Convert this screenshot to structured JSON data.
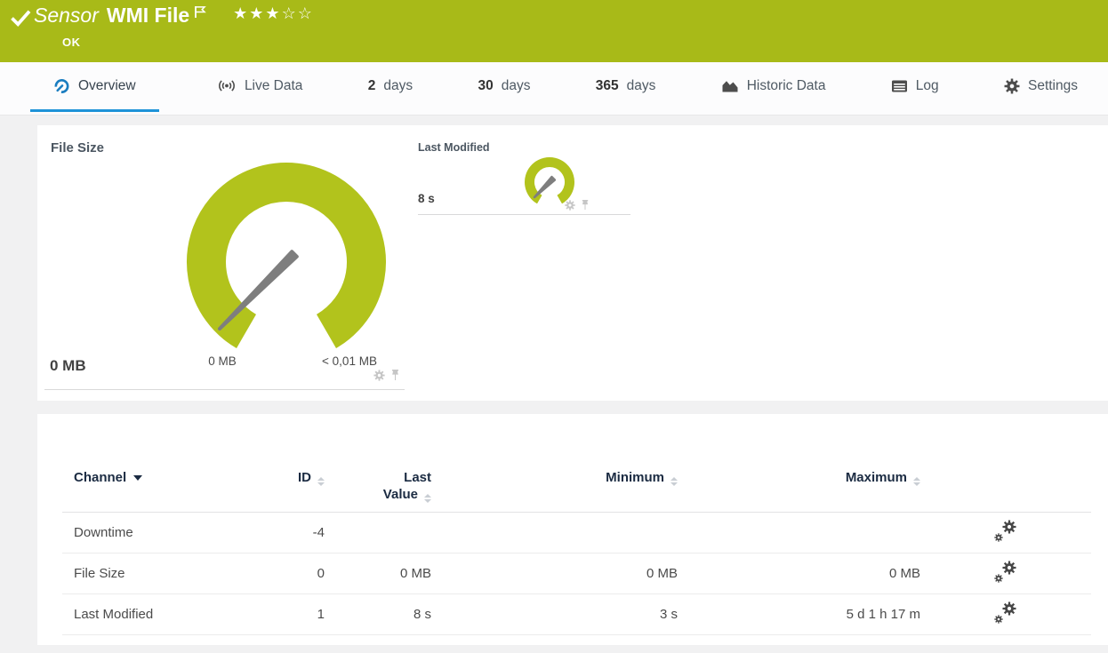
{
  "header": {
    "kind": "Sensor",
    "title": "WMI File",
    "status": "OK",
    "rating": {
      "filled_stars": "★★★",
      "empty_stars": "☆☆"
    }
  },
  "tabs": {
    "overview": "Overview",
    "live_data": "Live Data",
    "days2_value": "2",
    "days2_unit": "days",
    "days30_value": "30",
    "days30_unit": "days",
    "days365_value": "365",
    "days365_unit": "days",
    "historic_data": "Historic Data",
    "log": "Log",
    "settings": "Settings"
  },
  "gauges": {
    "file_size": {
      "title": "File Size",
      "current_value": "0 MB",
      "scale_min_label": "0 MB",
      "scale_max_label": "< 0,01 MB"
    },
    "last_modified": {
      "title": "Last Modified",
      "current_value": "8 s"
    }
  },
  "channel_table": {
    "headers": {
      "channel": "Channel",
      "id": "ID",
      "last_value_line1": "Last",
      "last_value_line2": "Value",
      "minimum": "Minimum",
      "maximum": "Maximum"
    },
    "rows": [
      {
        "channel": "Downtime",
        "id": "-4",
        "last_value": "",
        "minimum": "",
        "maximum": ""
      },
      {
        "channel": "File Size",
        "id": "0",
        "last_value": "0 MB",
        "minimum": "0 MB",
        "maximum": "0 MB"
      },
      {
        "channel": "Last Modified",
        "id": "1",
        "last_value": "8 s",
        "minimum": "3 s",
        "maximum": "5 d 1 h 17 m"
      }
    ]
  },
  "colors": {
    "brand_green": "#a8ba18",
    "gauge_green": "#b2c31c",
    "active_tab_blue": "#1e93d8",
    "needle_gray": "#7e7e7e"
  }
}
